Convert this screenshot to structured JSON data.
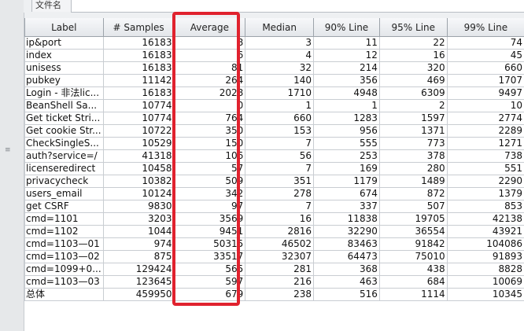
{
  "tab_label": "文件名",
  "columns": [
    "Label",
    "# Samples",
    "Average",
    "Median",
    "90% Line",
    "95% Line",
    "99% Line"
  ],
  "rows": [
    [
      "ip&port",
      "16183",
      "8",
      "3",
      "11",
      "22",
      "74"
    ],
    [
      "index",
      "16183",
      "6",
      "4",
      "12",
      "16",
      "45"
    ],
    [
      "unisess",
      "16183",
      "81",
      "32",
      "214",
      "320",
      "660"
    ],
    [
      "pubkey",
      "11142",
      "264",
      "140",
      "356",
      "469",
      "1707"
    ],
    [
      "Login - 非法lic...",
      "16183",
      "2028",
      "1710",
      "4948",
      "6309",
      "9497"
    ],
    [
      "BeanShell Sa...",
      "10774",
      "0",
      "1",
      "1",
      "2",
      "10"
    ],
    [
      "Get ticket Stri...",
      "10774",
      "764",
      "660",
      "1283",
      "1597",
      "2774"
    ],
    [
      "Get cookie Str...",
      "10722",
      "350",
      "153",
      "956",
      "1371",
      "2289"
    ],
    [
      "CheckSingleS...",
      "10529",
      "150",
      "7",
      "555",
      "773",
      "1271"
    ],
    [
      "auth?service=/",
      "41318",
      "106",
      "56",
      "253",
      "378",
      "738"
    ],
    [
      "licenseredirect",
      "10458",
      "57",
      "7",
      "169",
      "280",
      "551"
    ],
    [
      "privacycheck",
      "10382",
      "509",
      "351",
      "1179",
      "1489",
      "2290"
    ],
    [
      "users_email",
      "10124",
      "342",
      "278",
      "674",
      "872",
      "1379"
    ],
    [
      "get CSRF",
      "9830",
      "97",
      "7",
      "337",
      "507",
      "853"
    ],
    [
      "cmd=1101",
      "3203",
      "3569",
      "16",
      "11838",
      "19705",
      "42138"
    ],
    [
      "cmd=1102",
      "1044",
      "9451",
      "2816",
      "32290",
      "36554",
      "43921"
    ],
    [
      "cmd=1103—01",
      "974",
      "50315",
      "46502",
      "83463",
      "91842",
      "104086"
    ],
    [
      "cmd=1103—02",
      "875",
      "33517",
      "32307",
      "64473",
      "75010",
      "91893"
    ],
    [
      "cmd=1099+0...",
      "129424",
      "565",
      "281",
      "368",
      "438",
      "8828"
    ],
    [
      "cmd=1103—03",
      "123645",
      "597",
      "216",
      "463",
      "684",
      "10069"
    ],
    [
      "总体",
      "459950",
      "679",
      "238",
      "516",
      "1114",
      "10345"
    ]
  ],
  "colors": {
    "highlight": "#e0222e",
    "header_bg": "#e9ecef",
    "grid": "#c9cdd2"
  },
  "icons": {
    "left_grip": "grip-dots-icon"
  }
}
